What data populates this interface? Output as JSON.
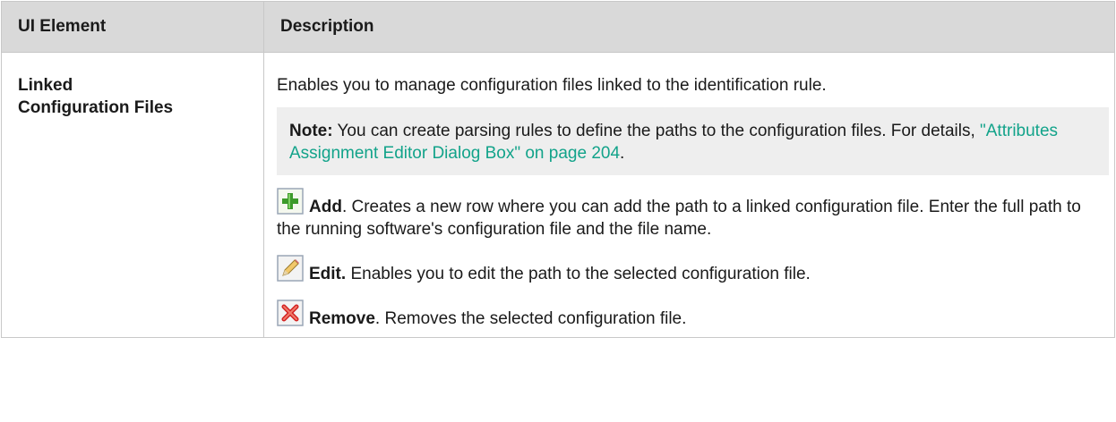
{
  "table": {
    "headers": {
      "ui_element": "UI Element",
      "description": "Description"
    },
    "row": {
      "ui_element": "Linked\nConfiguration Files",
      "intro": "Enables you to manage configuration files linked to the identification rule.",
      "note": {
        "label": "Note:",
        "text": " You can create parsing rules to define the paths to the configuration files. For details, ",
        "link": "\"Attributes Assignment Editor Dialog Box\" on page 204",
        "after": "."
      },
      "items": [
        {
          "icon": "add-icon",
          "label": "Add",
          "text": ". Creates a new row where you can add the path to a linked configuration file. Enter the full path to the running software's configuration file and the file name."
        },
        {
          "icon": "edit-pencil-icon",
          "label": "Edit.",
          "text": " Enables you to edit the path to the selected configuration file."
        },
        {
          "icon": "remove-icon",
          "label": "Remove",
          "text": ". Removes the selected configuration file."
        }
      ]
    }
  },
  "colors": {
    "header_bg": "#d9d9d9",
    "note_bg": "#eeeeee",
    "link": "#12a38a",
    "border": "#c8c8c8"
  }
}
